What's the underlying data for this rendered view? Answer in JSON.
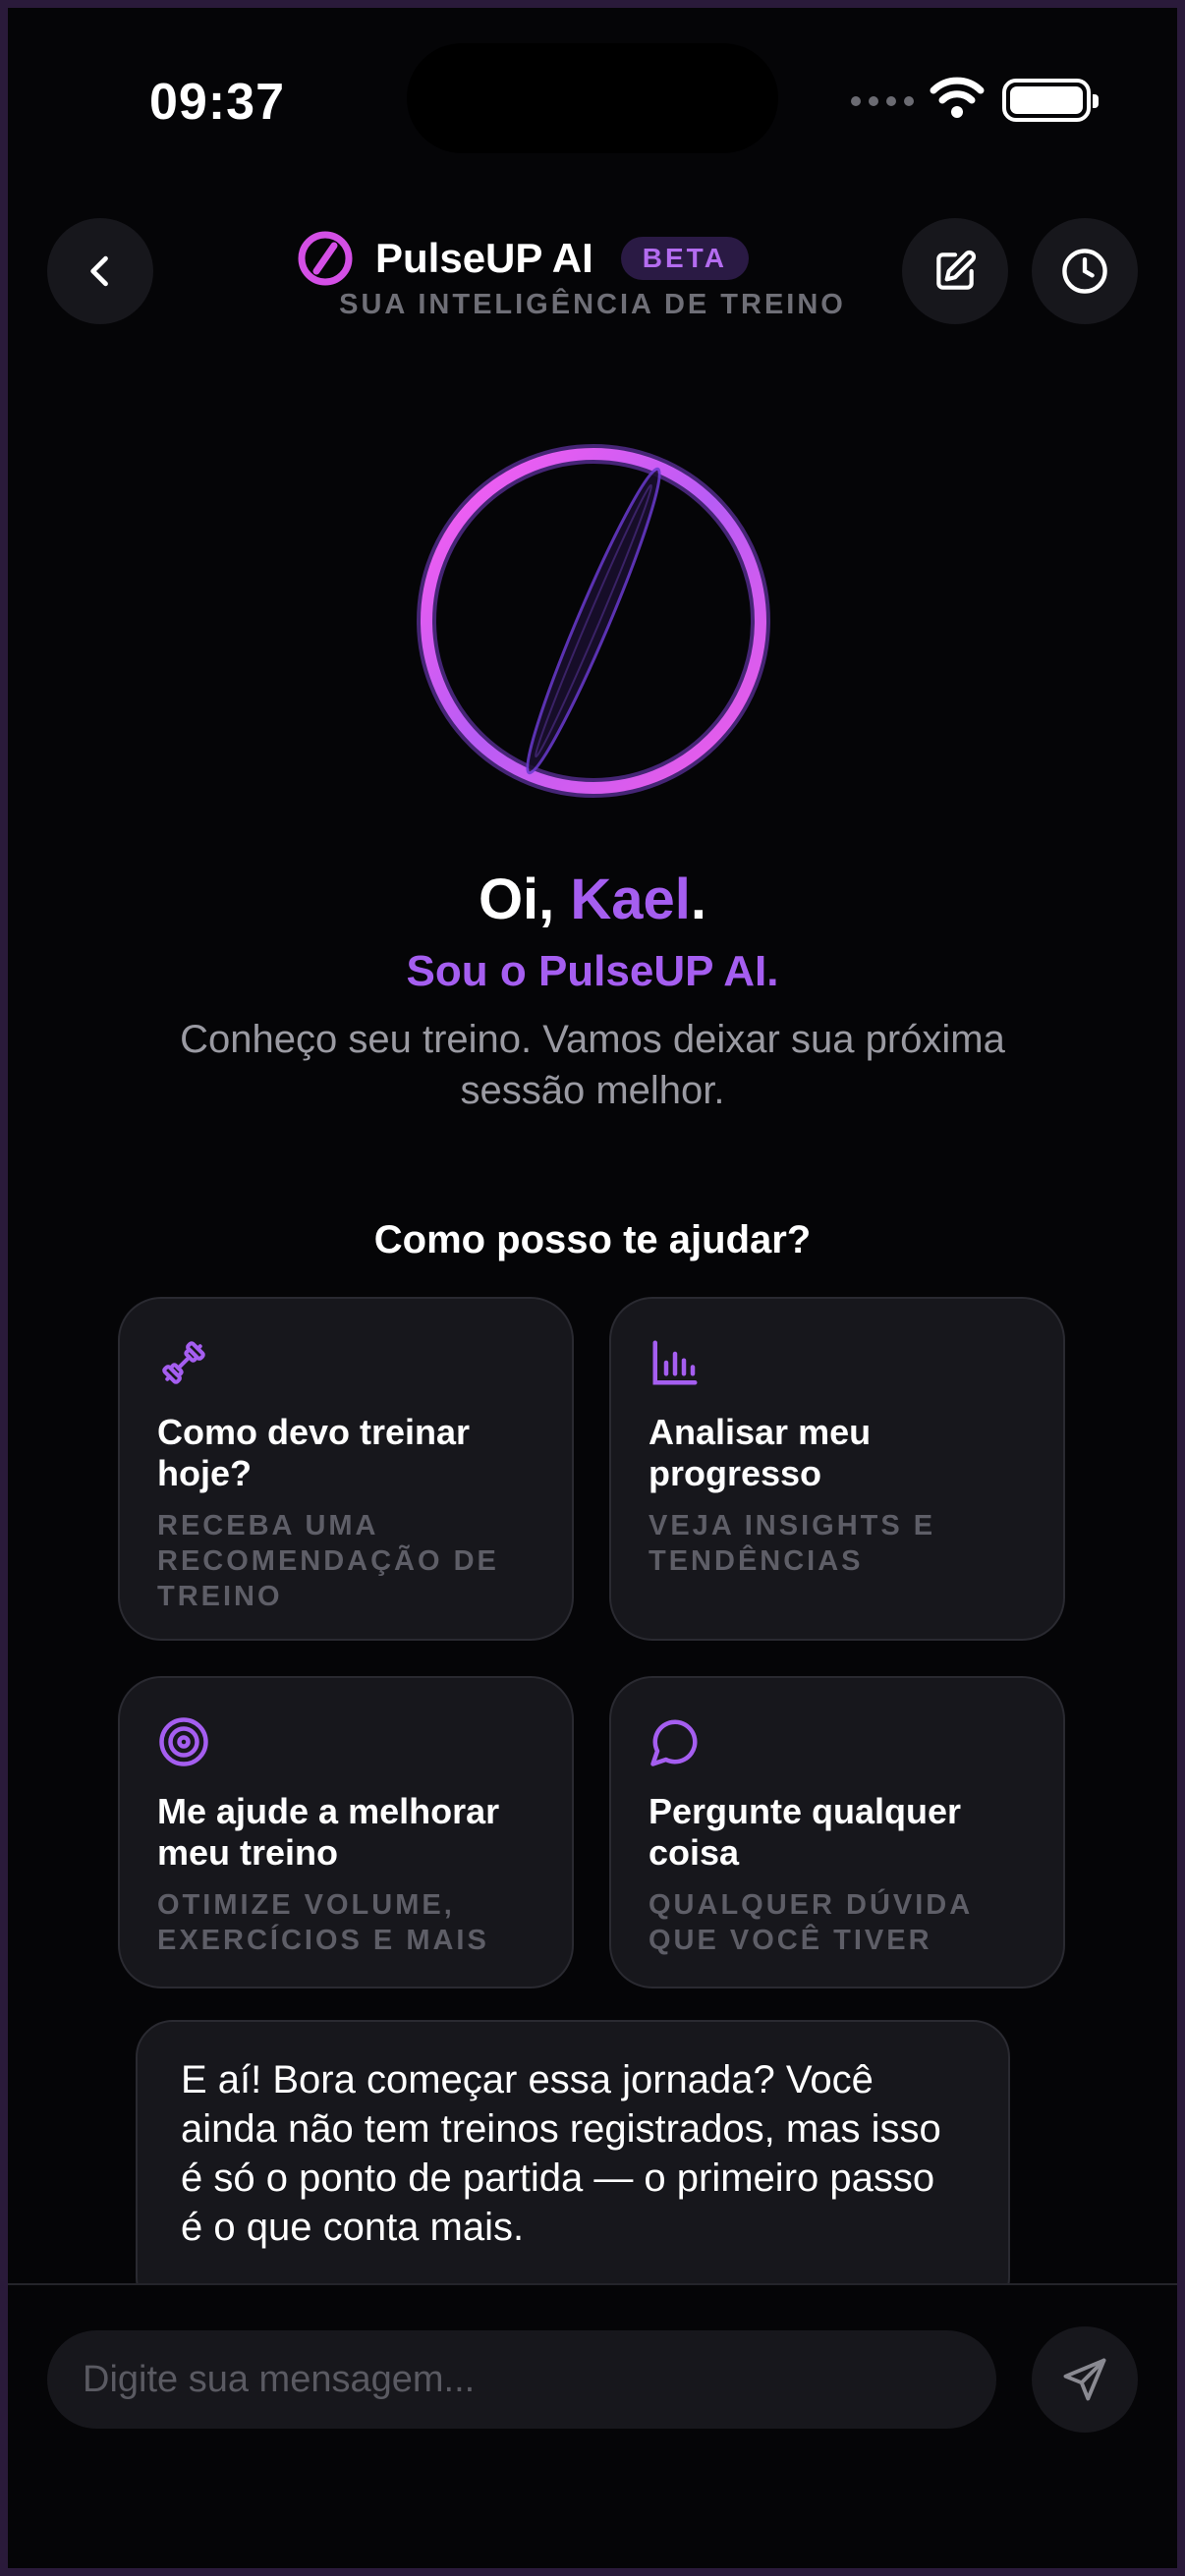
{
  "status_bar": {
    "time": "09:37"
  },
  "header": {
    "title": "PulseUP AI",
    "badge": "BETA",
    "subtitle": "SUA INTELIGÊNCIA DE TREINO",
    "icons": {
      "back": "chevron-left-icon",
      "edit": "edit-icon",
      "history": "clock-icon",
      "logo": "pulse-logo-icon"
    }
  },
  "greeting": {
    "prefix": "Oi, ",
    "name": "Kael",
    "suffix": ".",
    "intro": "Sou o PulseUP AI.",
    "tagline": "Conheço seu treino. Vamos deixar sua próxima sessão melhor."
  },
  "help_title": "Como posso te ajudar?",
  "suggestions": [
    {
      "icon": "dumbbell-icon",
      "title": "Como devo treinar hoje?",
      "desc": "RECEBA UMA RECOMENDAÇÃO DE TREINO"
    },
    {
      "icon": "bar-chart-icon",
      "title": "Analisar meu progresso",
      "desc": "VEJA INSIGHTS E TENDÊNCIAS"
    },
    {
      "icon": "target-icon",
      "title": "Me ajude a melhorar meu treino",
      "desc": "OTIMIZE VOLUME, EXERCÍCIOS E MAIS"
    },
    {
      "icon": "chat-bubble-icon",
      "title": "Pergunte qualquer coisa",
      "desc": "QUALQUER DÚVIDA QUE VOCÊ TIVER"
    }
  ],
  "assistant_message": "E aí! Bora começar essa jornada? Você ainda não tem treinos registrados, mas isso é só o ponto de partida — o primeiro passo é o que conta mais.",
  "composer": {
    "placeholder": "Digite sua mensagem...",
    "value": "",
    "send_icon": "send-icon"
  },
  "colors": {
    "accent": "#a55ef0",
    "accent_pink": "#e05ce8",
    "background": "#050507",
    "card": "#17171c"
  }
}
